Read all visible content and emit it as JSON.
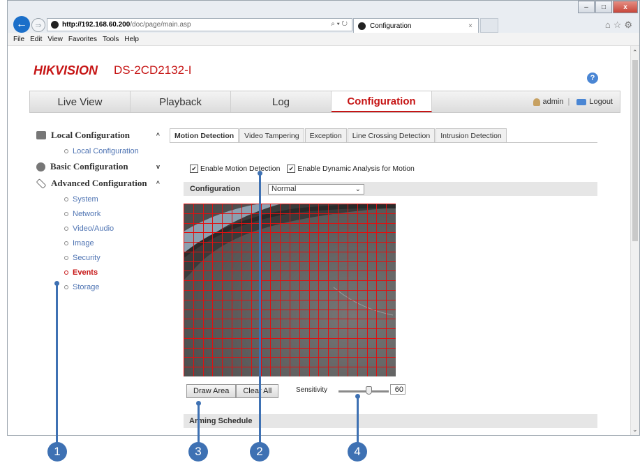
{
  "browser": {
    "address": {
      "host": "http://192.168.60.200",
      "path": "/doc/page/main.asp",
      "controls": "⌕ ▾ ↻"
    },
    "tab_title": "Configuration",
    "tab_close": "×",
    "window_buttons": [
      "–",
      "□",
      "x"
    ],
    "menu": [
      "File",
      "Edit",
      "View",
      "Favorites",
      "Tools",
      "Help"
    ]
  },
  "header": {
    "brand": "HIKVISION",
    "model": "DS-2CD2132-I",
    "help": "?"
  },
  "nav": {
    "items": [
      "Live View",
      "Playback",
      "Log",
      "Configuration"
    ],
    "active": "Configuration",
    "user": "admin",
    "separator": "|",
    "logout": "Logout"
  },
  "sidebar": {
    "groups": [
      {
        "label": "Local Configuration",
        "chevron": "^",
        "items": [
          "Local Configuration"
        ]
      },
      {
        "label": "Basic Configuration",
        "chevron": "v",
        "items": []
      },
      {
        "label": "Advanced Configuration",
        "chevron": "^",
        "items": [
          "System",
          "Network",
          "Video/Audio",
          "Image",
          "Security",
          "Events",
          "Storage"
        ]
      }
    ],
    "active_item": "Events"
  },
  "content": {
    "tabs": [
      "Motion Detection",
      "Video Tampering",
      "Exception",
      "Line Crossing Detection",
      "Intrusion Detection"
    ],
    "active_tab": "Motion Detection",
    "enable_motion_label": "Enable Motion Detection",
    "enable_dynamic_label": "Enable Dynamic Analysis for Motion",
    "enable_motion_checked": true,
    "enable_dynamic_checked": true,
    "configuration_label": "Configuration",
    "configuration_value": "Normal",
    "draw_area_label": "Draw Area",
    "clear_all_label": "Clear All",
    "sensitivity_label": "Sensitivity",
    "sensitivity_value": "60",
    "sensitivity_level": 0.6,
    "arming_schedule_label": "Arming Schedule",
    "grid_color": "#e01010"
  },
  "callouts": [
    "1",
    "2",
    "3",
    "4"
  ],
  "colors": {
    "brand_red": "#c61515",
    "callout_blue": "#3e71b3",
    "link_blue": "#4f74b3"
  }
}
